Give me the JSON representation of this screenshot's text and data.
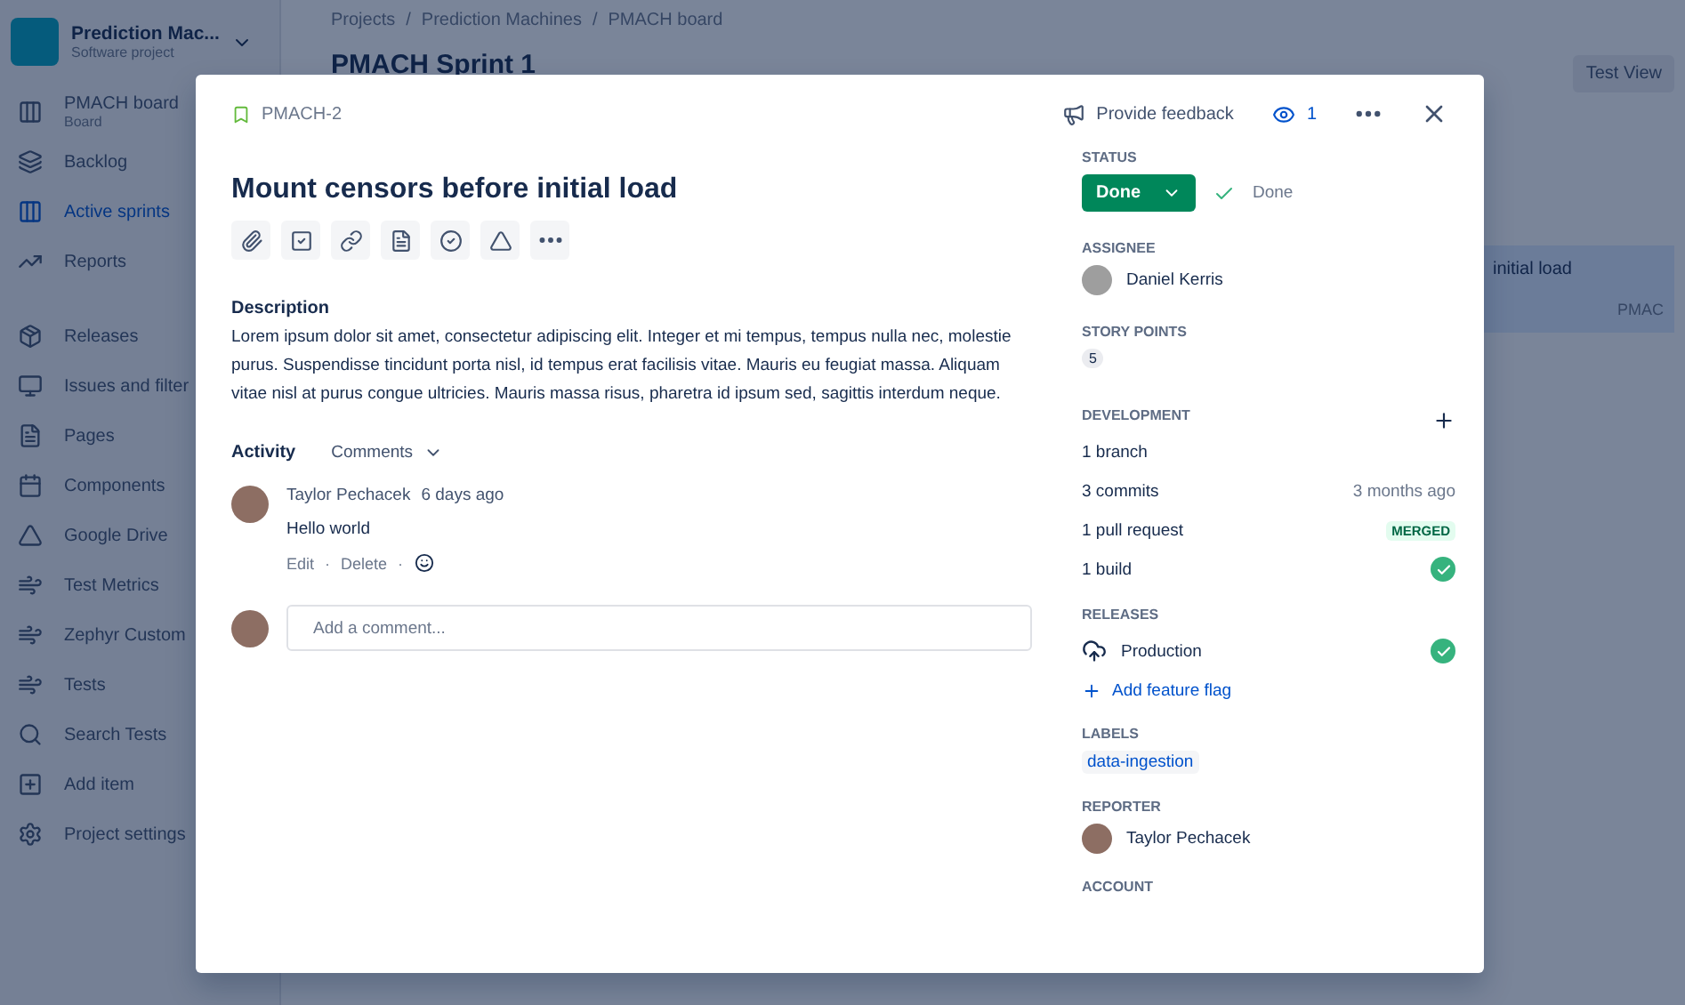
{
  "sidebar": {
    "project": {
      "name": "Prediction Mac...",
      "type": "Software project"
    },
    "groups": [
      [
        {
          "label": "PMACH board",
          "sublabel": "Board",
          "selected": false
        },
        {
          "label": "Backlog",
          "selected": false
        },
        {
          "label": "Active sprints",
          "selected": true
        },
        {
          "label": "Reports",
          "selected": false
        }
      ],
      [
        {
          "label": "Releases",
          "selected": false
        },
        {
          "label": "Issues and filter",
          "selected": false
        },
        {
          "label": "Pages",
          "selected": false
        },
        {
          "label": "Components",
          "selected": false
        },
        {
          "label": "Google Drive",
          "selected": false
        },
        {
          "label": "Test Metrics",
          "selected": false
        },
        {
          "label": "Zephyr Custom",
          "selected": false
        },
        {
          "label": "Tests",
          "selected": false
        },
        {
          "label": "Search Tests",
          "selected": false
        },
        {
          "label": "Add item",
          "selected": false
        },
        {
          "label": "Project settings",
          "selected": false
        }
      ]
    ]
  },
  "board": {
    "breadcrumb": [
      "Projects",
      "Prediction Machines",
      "PMACH board"
    ],
    "breadcrumb_separator": "/",
    "title": "PMACH Sprint 1",
    "actions": [
      "Test View"
    ],
    "card": {
      "title": "initial load",
      "key": "PMAC"
    }
  },
  "issue": {
    "key": "PMACH-2",
    "feedback": "Provide feedback",
    "watchers": "1",
    "title": "Mount censors before initial load",
    "description": {
      "heading": "Description",
      "text": "Lorem ipsum dolor sit amet, consectetur adipiscing elit. Integer et mi tempus, tempus nulla nec, molestie purus. Suspendisse tincidunt porta nisl, id tempus erat facilisis vitae. Mauris eu feugiat massa. Aliquam vitae nisl at purus congue ultricies. Mauris massa risus, pharetra id ipsum sed, sagittis interdum neque."
    },
    "activity": {
      "heading": "Activity",
      "filter": "Comments"
    },
    "comments": [
      {
        "author": "Taylor Pechacek",
        "time": "6 days ago",
        "text": "Hello world",
        "actions": [
          "Edit",
          "Delete"
        ],
        "separator": "·"
      }
    ],
    "comment_box": {
      "placeholder": "Add a comment..."
    },
    "status": {
      "label": "STATUS",
      "value": "Done",
      "resolution": "Done"
    },
    "assignee": {
      "label": "ASSIGNEE",
      "name": "Daniel Kerris"
    },
    "story_points": {
      "label": "STORY POINTS",
      "value": "5"
    },
    "development": {
      "label": "DEVELOPMENT",
      "rows": [
        {
          "kind": "plain",
          "label": "1 branch"
        },
        {
          "kind": "time",
          "label": "3 commits",
          "meta": "3 months ago"
        },
        {
          "kind": "lozenge",
          "label": "1 pull request",
          "meta": "MERGED"
        },
        {
          "kind": "check",
          "label": "1 build"
        }
      ]
    },
    "releases": {
      "label": "RELEASES",
      "items": [
        {
          "name": "Production",
          "kind": "check"
        }
      ],
      "link": "Add feature flag"
    },
    "labels": {
      "label": "LABELS",
      "items": [
        "data-ingestion"
      ]
    },
    "reporter": {
      "label": "REPORTER",
      "name": "Taylor Pechacek"
    },
    "account": {
      "label": "ACCOUNT"
    }
  }
}
